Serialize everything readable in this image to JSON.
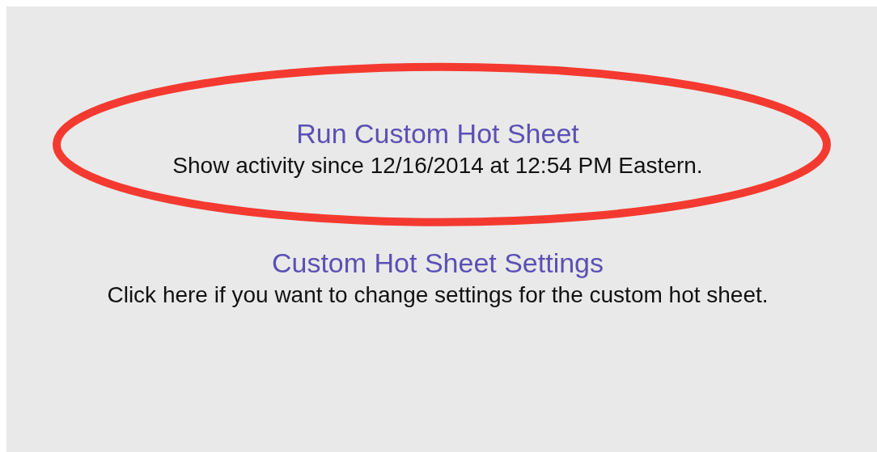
{
  "links": [
    {
      "title": "Run Custom Hot Sheet",
      "description": "Show activity since 12/16/2014 at 12:54 PM Eastern.",
      "highlighted": true
    },
    {
      "title": "Custom Hot Sheet Settings",
      "description": "Click here if you want to change settings for the custom hot sheet.",
      "highlighted": false
    }
  ]
}
